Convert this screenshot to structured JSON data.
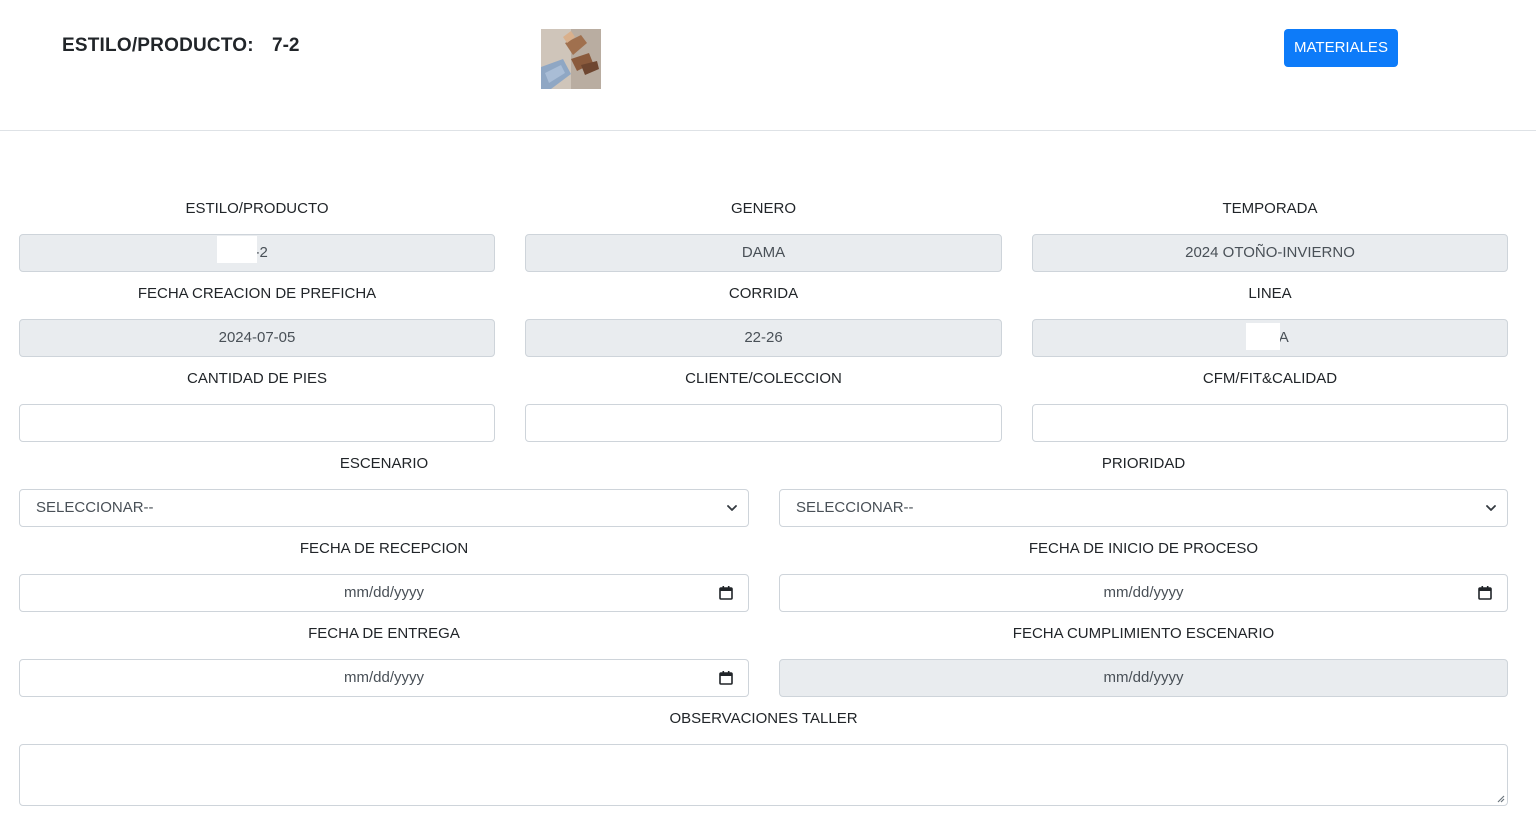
{
  "header": {
    "title": "ESTILO/PRODUCTO:",
    "code": "7-2",
    "materials_button": "MATERIALES"
  },
  "form": {
    "estilo": {
      "label": "ESTILO/PRODUCTO",
      "value": "7-2"
    },
    "genero": {
      "label": "GENERO",
      "value": "DAMA"
    },
    "temporada": {
      "label": "TEMPORADA",
      "value": "2024 OTOÑO-INVIERNO"
    },
    "fecha_creacion": {
      "label": "FECHA CREACION DE PREFICHA",
      "value": "2024-07-05"
    },
    "corrida": {
      "label": "CORRIDA",
      "value": "22-26"
    },
    "linea": {
      "label": "LINEA",
      "value": "M DA"
    },
    "cantidad_pies": {
      "label": "CANTIDAD DE PIES",
      "value": ""
    },
    "cliente": {
      "label": "CLIENTE/COLECCION",
      "value": ""
    },
    "cfm": {
      "label": "CFM/FIT&CALIDAD",
      "value": ""
    },
    "escenario": {
      "label": "ESCENARIO",
      "value": "SELECCIONAR--"
    },
    "prioridad": {
      "label": "PRIORIDAD",
      "value": "SELECCIONAR--"
    },
    "fecha_recepcion": {
      "label": "FECHA DE RECEPCION",
      "placeholder": "mm/dd/yyyy"
    },
    "fecha_inicio": {
      "label": "FECHA DE INICIO DE PROCESO",
      "placeholder": "mm/dd/yyyy"
    },
    "fecha_entrega": {
      "label": "FECHA DE ENTREGA",
      "placeholder": "mm/dd/yyyy"
    },
    "fecha_cumplimiento": {
      "label": "FECHA CUMPLIMIENTO ESCENARIO",
      "placeholder": "mm/dd/yyyy"
    },
    "observaciones": {
      "label": "OBSERVACIONES TALLER",
      "value": ""
    }
  },
  "icons": {
    "select": "chevron-down-icon",
    "date": "calendar-icon",
    "textarea": "resize-handle-icon"
  },
  "colors": {
    "primary": "#0d7bf9",
    "readonly_bg": "#e9ecef",
    "border": "#ced4da"
  }
}
